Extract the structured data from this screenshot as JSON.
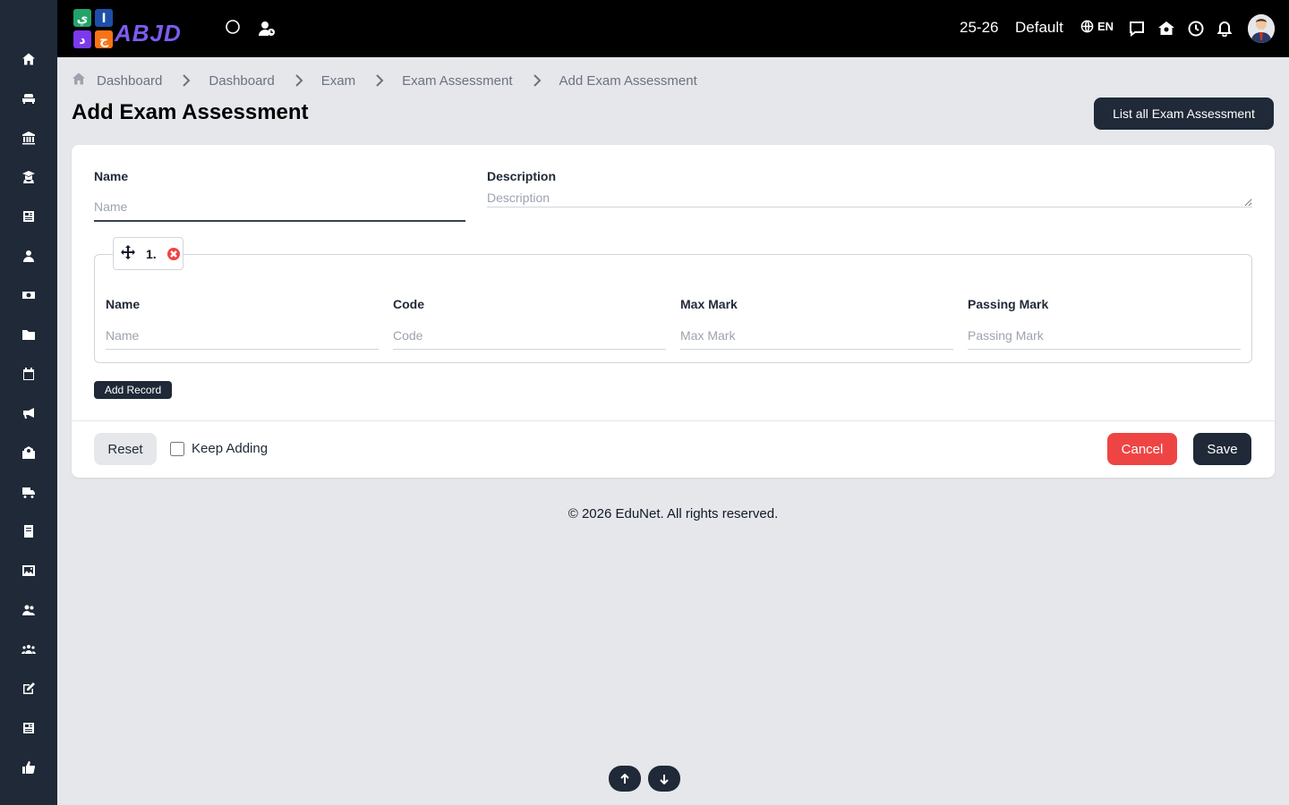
{
  "sidebar": {
    "items": [
      {
        "icon": "home-icon"
      },
      {
        "icon": "sofa-icon"
      },
      {
        "icon": "bank-icon"
      },
      {
        "icon": "graduate-icon"
      },
      {
        "icon": "newspaper-icon"
      },
      {
        "icon": "user-icon"
      },
      {
        "icon": "money-icon"
      },
      {
        "icon": "folder-icon"
      },
      {
        "icon": "calendar-icon"
      },
      {
        "icon": "megaphone-icon"
      },
      {
        "icon": "school-icon"
      },
      {
        "icon": "truck-icon"
      },
      {
        "icon": "book-icon"
      },
      {
        "icon": "image-icon"
      },
      {
        "icon": "users-icon"
      },
      {
        "icon": "group-icon"
      },
      {
        "icon": "edit-icon"
      },
      {
        "icon": "news-icon"
      },
      {
        "icon": "thumbs-up-icon"
      }
    ]
  },
  "topbar": {
    "logo_text": "ABJD",
    "session": "25-26",
    "profile": "Default",
    "language": "EN"
  },
  "breadcrumb": [
    "Dashboard",
    "Dashboard",
    "Exam",
    "Exam Assessment",
    "Add Exam Assessment"
  ],
  "page": {
    "title": "Add Exam Assessment",
    "list_button": "List all Exam Assessment"
  },
  "form": {
    "name_label": "Name",
    "name_placeholder": "Name",
    "description_label": "Description",
    "description_placeholder": "Description",
    "record": {
      "index": "1.",
      "fields": [
        {
          "label": "Name",
          "placeholder": "Name"
        },
        {
          "label": "Code",
          "placeholder": "Code"
        },
        {
          "label": "Max Mark",
          "placeholder": "Max Mark"
        },
        {
          "label": "Passing Mark",
          "placeholder": "Passing Mark"
        }
      ]
    },
    "add_record": "Add Record",
    "reset": "Reset",
    "keep_adding": "Keep Adding",
    "cancel": "Cancel",
    "save": "Save"
  },
  "footer": "© 2026 EduNet. All rights reserved.",
  "colors": {
    "dark": "#1f2937",
    "danger": "#ef4444",
    "background": "#e5e7eb"
  }
}
